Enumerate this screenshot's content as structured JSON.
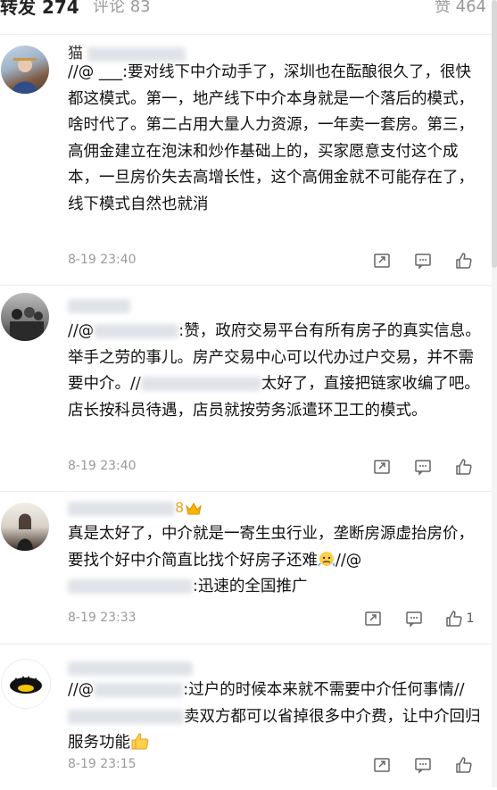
{
  "tabs": {
    "repost": "转发 274",
    "comment": "评论 83",
    "like": "赞 464"
  },
  "comments": [
    {
      "name_prefix": "猫",
      "body": "//@ ___:要对线下中介动手了，深圳也在酝酿很久了，很快都这模式。第一，地产线下中介本身就是一个落后的模式，啥时代了。第二占用大量人力资源，一年卖一套房。第三，高佣金建立在泡沫和炒作基础上的，买家愿意支付这个成本，一旦房价失去高增长性，这个高佣金就不可能存在了，线下模式自然也就消",
      "time": "8-19 23:40",
      "like_count": ""
    },
    {
      "name_prefix": "",
      "body_part1": "//@",
      "body_part2": ":赞，政府交易平台有所有房子的真实信息。举手之劳的事儿。房产交易中心可以代办过户交易，并不需要中介。//",
      "body_part3": "太好了，直接把链家收编了吧。店长按科员待遇，店员就按劳务派遣环卫工的模式。",
      "time": "8-19 23:40",
      "like_count": ""
    },
    {
      "name_suffix": "8",
      "body_part1": "真是太好了，中介就是一寄生虫行业，垄断房源虚抬房价，要找个好中介简直比找个好房子还难",
      "body_part2": "//@",
      "body_part3": ":迅速的全国推广",
      "time": "8-19 23:33",
      "like_count": "1"
    },
    {
      "name_prefix": "",
      "body_part1": "//@",
      "body_part2": ":过户的时候本来就不需要中介任何事情//",
      "body_part3": "卖双方都可以省掉很多中介费，让中介回归服务功能",
      "time": "8-19 23:15",
      "like_count": ""
    }
  ]
}
